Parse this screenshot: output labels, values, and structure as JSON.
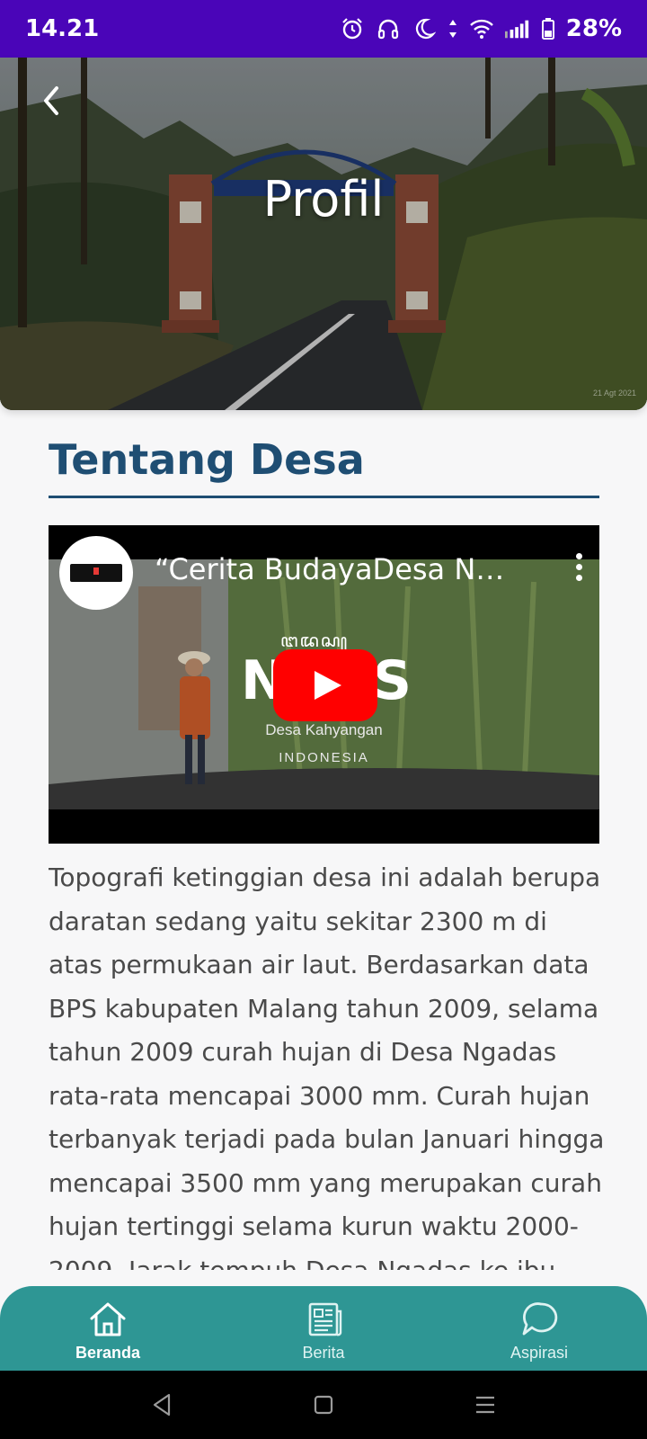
{
  "status_bar": {
    "time": "14.21",
    "battery": "28%",
    "icons": [
      "alarm-icon",
      "headphones-icon",
      "moon-icon",
      "data-arrows-icon",
      "wifi-icon",
      "signal-icon",
      "battery-icon"
    ]
  },
  "hero": {
    "title": "Profil",
    "back_icon": "chevron-left-icon",
    "photo_stamp": "21 Agt 2021"
  },
  "section": {
    "title": "Tentang Desa"
  },
  "video": {
    "title": "“Cerita BudayaDesa Ng...",
    "overlay_script": "ꦔꦢꦱ꧀",
    "overlay_name_left": "N",
    "overlay_name_right": "S",
    "overlay_subtitle": "Desa Kahyangan",
    "overlay_country": "INDONESIA",
    "play_button_color": "#ff0000"
  },
  "body": {
    "paragraph": "Topografi ketinggian desa ini adalah berupa daratan sedang yaitu sekitar 2300 m di atas permukaan air laut. Berdasarkan data BPS kabupaten Malang tahun 2009, selama tahun 2009 curah hujan di Desa Ngadas rata-rata mencapai 3000 mm. Curah hujan terbanyak terjadi pada bulan Januari hingga mencapai 3500 mm yang merupakan curah hujan tertinggi selama kurun waktu 2000-2009. Jarak tempuh Desa Ngadas ke ibu kota"
  },
  "bottom_nav": {
    "items": [
      {
        "label": "Beranda",
        "icon": "home-icon",
        "active": true
      },
      {
        "label": "Berita",
        "icon": "newspaper-icon",
        "active": false
      },
      {
        "label": "Aspirasi",
        "icon": "chat-bubble-icon",
        "active": false
      }
    ]
  },
  "colors": {
    "status_bar": "#4a05b8",
    "accent_title": "#1f4e73",
    "bottom_nav": "#2e9694",
    "body_text": "#4a4a4a"
  }
}
